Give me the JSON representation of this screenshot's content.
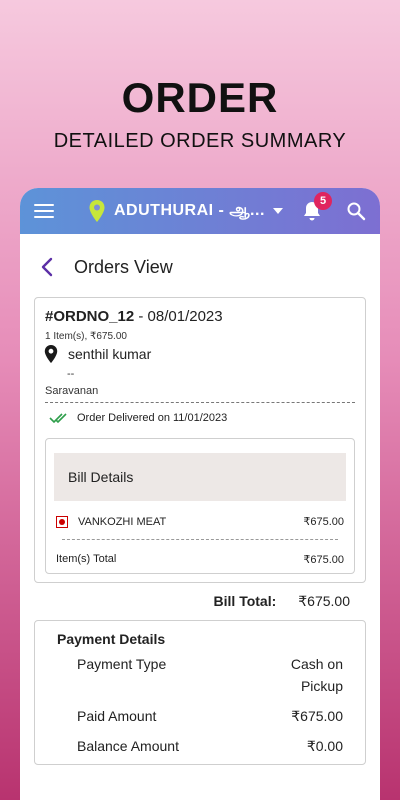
{
  "hero": {
    "title": "ORDER",
    "subtitle": "DETAILED ORDER SUMMARY"
  },
  "appbar": {
    "location": "ADUTHURAI - ஆ...",
    "notification_count": "5",
    "accent_start": "#5d93d8",
    "accent_end": "#7d6fd2",
    "pin_color": "#c7e63a"
  },
  "header": {
    "title": "Orders View"
  },
  "order": {
    "id": "#ORDNO_12",
    "date": " - 08/01/2023",
    "items_summary": "1 Item(s), ₹675.00",
    "customer_name": "senthil kumar",
    "customer_extra": "--",
    "staff": "Saravanan",
    "status_text": "Order Delivered on 11/01/2023"
  },
  "bill": {
    "header": "Bill Details",
    "items": [
      {
        "name": "VANKOZHI MEAT",
        "price": "₹675.00"
      }
    ],
    "items_total_label": "Item(s) Total",
    "items_total_value": "₹675.00",
    "bill_total_label": "Bill Total:",
    "bill_total_value": "₹675.00"
  },
  "payment": {
    "title": "Payment Details",
    "rows": [
      {
        "label": "Payment Type",
        "value": "Cash on Pickup"
      },
      {
        "label": "Paid Amount",
        "value": "₹675.00"
      },
      {
        "label": "Balance Amount",
        "value": "₹0.00"
      }
    ]
  }
}
